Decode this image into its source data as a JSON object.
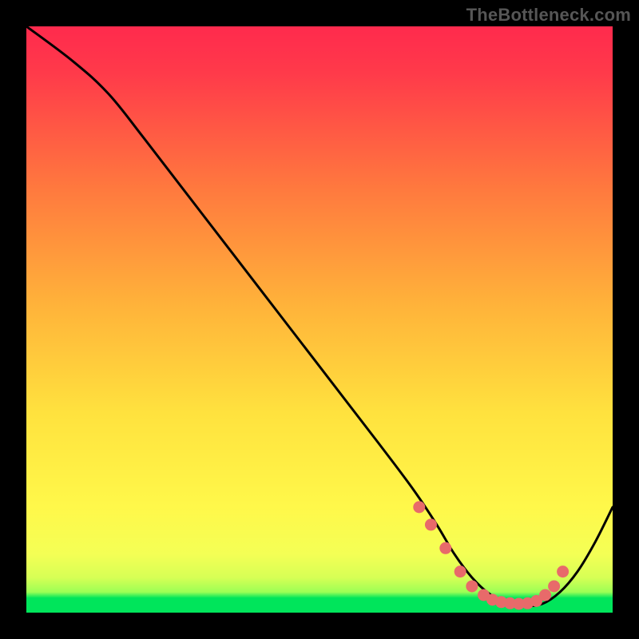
{
  "watermark": "TheBottleneck.com",
  "colors": {
    "frame": "#000000",
    "curve": "#000000",
    "dots": "#e86a6a",
    "top_gradient": "#ff2a4d",
    "mid_gradient": "#ffd400",
    "bottom_band": "#00e55b"
  },
  "chart_data": {
    "type": "line",
    "title": "",
    "xlabel": "",
    "ylabel": "",
    "xlim": [
      0,
      100
    ],
    "ylim": [
      0,
      100
    ],
    "series": [
      {
        "name": "curve",
        "x": [
          0,
          8,
          14,
          20,
          30,
          40,
          50,
          60,
          66,
          70,
          73,
          76,
          79,
          82,
          85,
          88,
          91,
          94,
          97,
          100
        ],
        "y": [
          100,
          94,
          88.5,
          81,
          68,
          55,
          42,
          29,
          21,
          15,
          10,
          6,
          3.2,
          1.8,
          1.2,
          1.5,
          3.5,
          7,
          12,
          18
        ]
      }
    ],
    "valley_dots": {
      "x": [
        67,
        69,
        71.5,
        74,
        76,
        78,
        79.5,
        81,
        82.5,
        84,
        85.5,
        87,
        88.5,
        90,
        91.5
      ],
      "y": [
        18,
        15,
        11,
        7,
        4.5,
        3,
        2.2,
        1.8,
        1.6,
        1.5,
        1.6,
        2,
        3,
        4.5,
        7
      ]
    },
    "green_band_y": 2.5
  }
}
